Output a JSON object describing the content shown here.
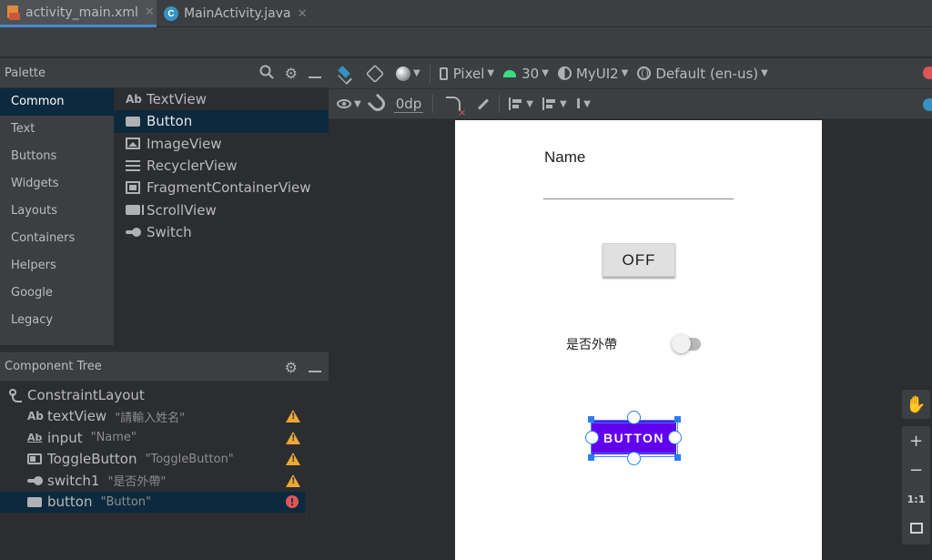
{
  "tabs": [
    {
      "label": "activity_main.xml",
      "active": true,
      "icon": "xml-layout-icon"
    },
    {
      "label": "MainActivity.java",
      "active": false,
      "icon": "java-class-icon"
    }
  ],
  "palette": {
    "title": "Palette",
    "categories": [
      "Common",
      "Text",
      "Buttons",
      "Widgets",
      "Layouts",
      "Containers",
      "Helpers",
      "Google",
      "Legacy"
    ],
    "selected_category": "Common",
    "widgets": [
      {
        "label": "TextView",
        "icon": "Ab"
      },
      {
        "label": "Button",
        "icon": "button-icon"
      },
      {
        "label": "ImageView",
        "icon": "image-icon"
      },
      {
        "label": "RecyclerView",
        "icon": "list-icon"
      },
      {
        "label": "FragmentContainerView",
        "icon": "fragment-icon"
      },
      {
        "label": "ScrollView",
        "icon": "scroll-icon"
      },
      {
        "label": "Switch",
        "icon": "switch-icon"
      }
    ],
    "selected_widget": "Button"
  },
  "component_tree": {
    "title": "Component Tree",
    "nodes": [
      {
        "label": "ConstraintLayout",
        "hint": "",
        "status": "none"
      },
      {
        "label": "textView",
        "hint": "\"請輸入姓名\"",
        "status": "warning"
      },
      {
        "label": "input",
        "hint": "\"Name\"",
        "status": "warning"
      },
      {
        "label": "ToggleButton",
        "hint": "\"ToggleButton\"",
        "status": "warning"
      },
      {
        "label": "switch1",
        "hint": "\"是否外帶\"",
        "status": "warning"
      },
      {
        "label": "button",
        "hint": "\"Button\"",
        "status": "error",
        "selected": true
      }
    ]
  },
  "toolbar": {
    "device": "Pixel",
    "api_level": "30",
    "theme": "MyUI2",
    "locale": "Default (en-us)",
    "default_margin": "0dp"
  },
  "design": {
    "name_label": "Name",
    "toggle_text": "OFF",
    "switch_label": "是否外帶",
    "switch_on": false,
    "button_text": "BUTTON",
    "button_color": "#6200ee"
  },
  "zoom_tools": {
    "zoom_in": "+",
    "zoom_out": "−",
    "actual_size": "1:1"
  },
  "colors": {
    "accent": "#4a88c7",
    "selection": "#2d7cf2",
    "warning": "#f0a732",
    "error": "#e05555"
  }
}
